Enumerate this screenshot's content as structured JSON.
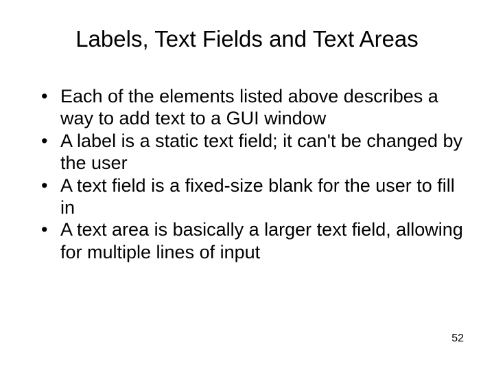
{
  "slide": {
    "title": "Labels, Text Fields and Text Areas",
    "bullets": [
      "Each of the elements listed above describes a way to add text to a GUI window",
      "A label is a static text field; it can't be changed by the user",
      "A text field is a fixed-size blank for the user to fill in",
      "A text area is basically a larger text field, allowing for multiple lines of input"
    ],
    "page_number": "52"
  }
}
